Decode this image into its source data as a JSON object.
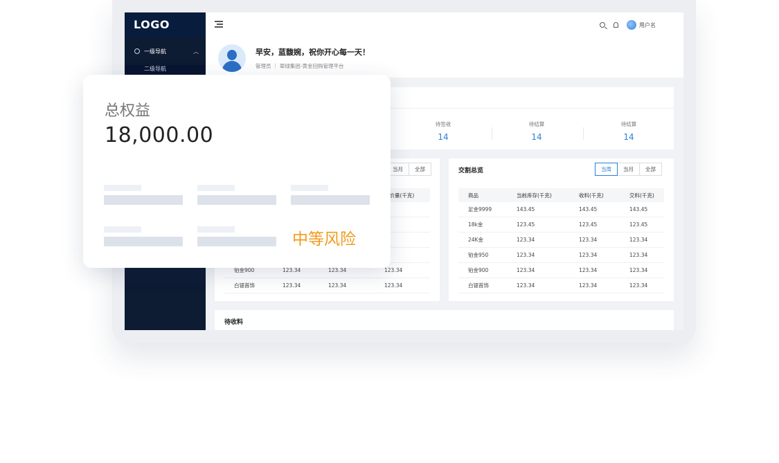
{
  "sidebar": {
    "logo": "LOGO",
    "nav_primary": "一级导航",
    "nav_secondary": "二级导航"
  },
  "topbar": {
    "username": "用户名",
    "icons": [
      "menu-fold-icon",
      "search-icon",
      "bell-icon",
      "user-avatar-icon"
    ]
  },
  "welcome": {
    "greeting": "早安，蓝馥婉，祝你开心每一天！",
    "role": "管理员",
    "org": "翠绿集团-黄金回购管理平台"
  },
  "stats": [
    {
      "label": "待签收",
      "value": "14"
    },
    {
      "label": "待结算",
      "value": "14"
    },
    {
      "label": "待结算",
      "value": "14"
    }
  ],
  "left_panel": {
    "tabs": [
      "当月",
      "全部"
    ],
    "columns_visible": [
      "定价量(千克)"
    ],
    "rows": [
      {
        "name": "铂金900",
        "c1": "123.34",
        "c2": "123.34",
        "c3": "123.34"
      },
      {
        "name": "白银首饰",
        "c1": "123.34",
        "c2": "123.34",
        "c3": "123.34"
      }
    ]
  },
  "right_panel": {
    "title": "交割总览",
    "tabs": [
      "当周",
      "当月",
      "全部"
    ],
    "active_tab": "当周",
    "columns": [
      "商品",
      "当前库存(千克)",
      "收料(千克)",
      "交料(千克)"
    ],
    "rows": [
      [
        "足金9999",
        "143.45",
        "143.45",
        "143.45"
      ],
      [
        "18k金",
        "123.45",
        "123.45",
        "123.45"
      ],
      [
        "24K金",
        "123.34",
        "123.34",
        "123.34"
      ],
      [
        "铂金950",
        "123.34",
        "123.34",
        "123.34"
      ],
      [
        "铂金900",
        "123.34",
        "123.34",
        "123.34"
      ],
      [
        "白银首饰",
        "123.34",
        "123.34",
        "123.34"
      ]
    ]
  },
  "bottom_panel": {
    "title": "待收料"
  },
  "float_card": {
    "label": "总权益",
    "value": "18,000.00",
    "risk": "中等风险",
    "risk_color": "#f29a1b"
  },
  "colors": {
    "accent": "#2b7fd6",
    "sidebar": "#0d1b33"
  }
}
